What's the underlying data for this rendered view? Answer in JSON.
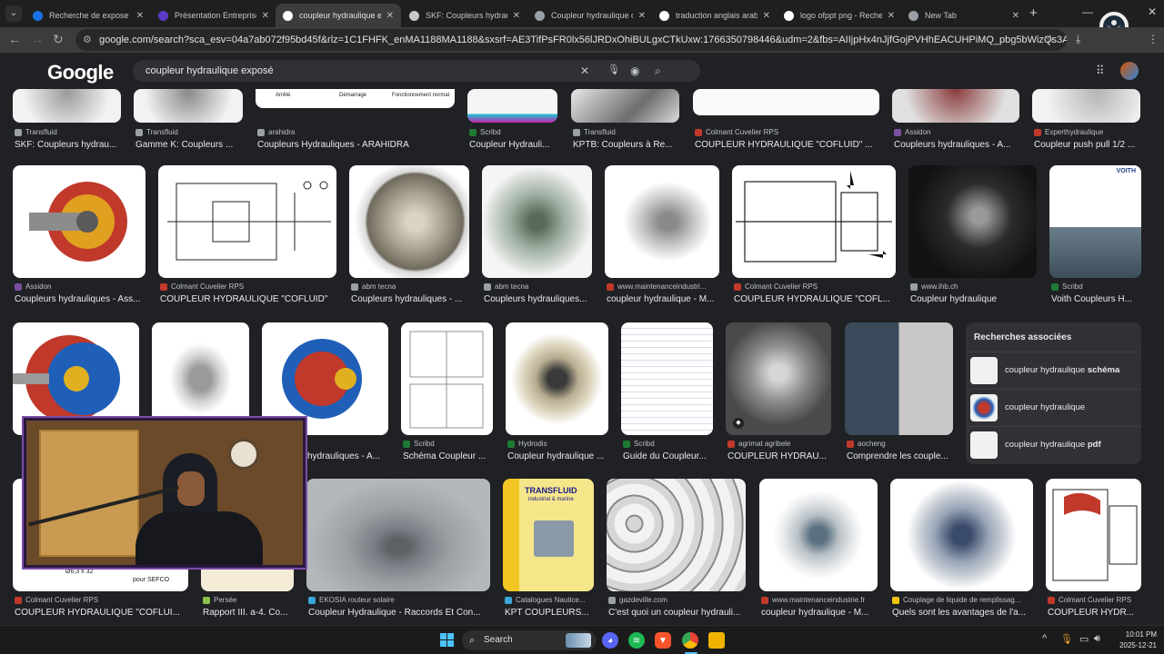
{
  "browser": {
    "tabs": [
      {
        "title": "Recherche de expose pou",
        "favicon_color": "#1a73e8",
        "active": false
      },
      {
        "title": "Présentation Entreprise",
        "favicon_color": "#5b3cc4",
        "active": false
      },
      {
        "title": "coupleur hydraulique ex",
        "favicon_color": "#ffffff",
        "active": true
      },
      {
        "title": "SKF: Coupleurs hydrauli",
        "favicon_color": "#c8c8c8",
        "active": false
      },
      {
        "title": "Coupleur hydraulique d",
        "favicon_color": "#9aa0a6",
        "active": false
      },
      {
        "title": "traduction anglais arab",
        "favicon_color": "#ffffff",
        "active": false
      },
      {
        "title": "logo ofppt png - Recher",
        "favicon_color": "#ffffff",
        "active": false
      },
      {
        "title": "New Tab",
        "favicon_color": "#9aa0a6",
        "active": false
      }
    ],
    "tab_close": "✕",
    "new_tab": "+",
    "url": "google.com/search?sca_esv=04a7ab072f95bd45f&rlz=1C1FHFK_enMA1188MA1188&sxsrf=AE3TifPsFR0lx56lJRDxOhiBULgxCTkUxw:1766350798446&udm=2&fbs=AIIjpHx4nJjfGojPVHhEACUHPiMQ_pbg5bWizQs3A_klenjtcpTTqBUdyVgzq0c3_..."
  },
  "google": {
    "logo": "Google",
    "query": "coupleur hydraulique exposé"
  },
  "results": [
    {
      "src": "Transfluid",
      "title": "SKF: Coupleurs hydrau...",
      "fav": "#9aa0a6"
    },
    {
      "src": "Transfluid",
      "title": "Gamme K: Coupleurs ...",
      "fav": "#9aa0a6"
    },
    {
      "src": "arahidra",
      "title": "Coupleurs Hydrauliques - ARAHIDRA",
      "fav": "#9aa0a6",
      "th1": "Arrêté",
      "th2": "Démarrage",
      "th3": "Fonctionnement normal"
    },
    {
      "src": "Scribd",
      "title": "Coupleur Hydrauli...",
      "fav": "#1e7b34"
    },
    {
      "src": "Transfluid",
      "title": "KPTB: Coupleurs à Re...",
      "fav": "#9aa0a6"
    },
    {
      "src": "Colmant Cuvelier RPS",
      "title": "COUPLEUR HYDRAULIQUE \"COFLUID\" ...",
      "fav": "#c0392b"
    },
    {
      "src": "Assidon",
      "title": "Coupleurs hydrauliques - A...",
      "fav": "#7b4fa0"
    },
    {
      "src": "Experthydraulique",
      "title": "Coupleur push pull 1/2 ...",
      "fav": "#c0392b"
    },
    {
      "src": "Assidon",
      "title": "Coupleurs hydrauliques - Ass...",
      "fav": "#7b4fa0"
    },
    {
      "src": "Colmant Cuvelier RPS",
      "title": "COUPLEUR HYDRAULIQUE \"COFLUID\"",
      "fav": "#c0392b"
    },
    {
      "src": "abm tecna",
      "title": "Coupleurs hydrauliques - ...",
      "fav": "#9aa0a6"
    },
    {
      "src": "abm tecna",
      "title": "Coupleurs hydrauliques...",
      "fav": "#9aa0a6"
    },
    {
      "src": "www.maintenanceindustri...",
      "title": "coupleur hydraulique - M...",
      "fav": "#c0392b"
    },
    {
      "src": "Colmant Cuvelier RPS",
      "title": "COUPLEUR HYDRAULIQUE \"COFL...",
      "fav": "#c0392b"
    },
    {
      "src": "www.ihb.ch",
      "title": "Coupleur hydraulique",
      "fav": "#9aa0a6"
    },
    {
      "src": "Scribd",
      "title": "Voith Coupleurs H...",
      "fav": "#1e7b34",
      "badge": "VOITH"
    },
    {
      "src": "",
      "title": "",
      "fav": "#7b4fa0"
    },
    {
      "src": "",
      "title": "",
      "fav": "#9aa0a6"
    },
    {
      "src": "",
      "title": "hydrauliques - A...",
      "fav": "#7b4fa0"
    },
    {
      "src": "Scribd",
      "title": "Schéma Coupleur ...",
      "fav": "#1e7b34"
    },
    {
      "src": "Hydrodis",
      "title": "Coupleur hydraulique ...",
      "fav": "#1e7b34"
    },
    {
      "src": "Scribd",
      "title": "Guide du Coupleur...",
      "fav": "#1e7b34"
    },
    {
      "src": "agrimat agribele",
      "title": "COUPLEUR HYDRAU...",
      "fav": "#c0392b"
    },
    {
      "src": "aocheng",
      "title": "Comprendre les couple...",
      "fav": "#c0392b"
    },
    {
      "src": "Colmant Cuvelier RPS",
      "title": "COUPLEUR HYDRAULIQUE \"COFLUI...",
      "fav": "#c0392b",
      "caption": "Ø6,3 x 32",
      "caption2": "pour SEFCO"
    },
    {
      "src": "Persée",
      "title": "Rapport III. a-4. Co...",
      "fav": "#8bc34a"
    },
    {
      "src": "EKOSIA routeur solaire",
      "title": "Coupleur Hydraulique - Raccords Et Con...",
      "fav": "#3aa7d8"
    },
    {
      "src": "Catalogues Nautice...",
      "title": "KPT COUPLEURS...",
      "fav": "#3aa7d8",
      "brand": "TRANSFLUID",
      "tagline": "industrial & marine"
    },
    {
      "src": "gazdeville.com",
      "title": "C'est quoi un coupleur hydrauli...",
      "fav": "#9aa0a6"
    },
    {
      "src": "www.maintenanceindustrie.fr",
      "title": "coupleur hydraulique - M...",
      "fav": "#c0392b"
    },
    {
      "src": "Couplage de liquide de remplissag...",
      "title": "Quels sont les avantages de l'a...",
      "fav": "#f1c40f"
    },
    {
      "src": "Colmant Cuvelier RPS",
      "title": "COUPLEUR HYDR...",
      "fav": "#c0392b"
    }
  ],
  "related": {
    "heading": "Recherches associées",
    "items": [
      {
        "prefix": "coupleur hydraulique ",
        "bold": "schéma"
      },
      {
        "prefix": "coupleur hydraulique",
        "bold": ""
      },
      {
        "prefix": "coupleur hydraulique ",
        "bold": "pdf"
      }
    ]
  },
  "taskbar": {
    "search_label": "Search",
    "time": "10:01 PM",
    "date": "2025-12-21"
  }
}
